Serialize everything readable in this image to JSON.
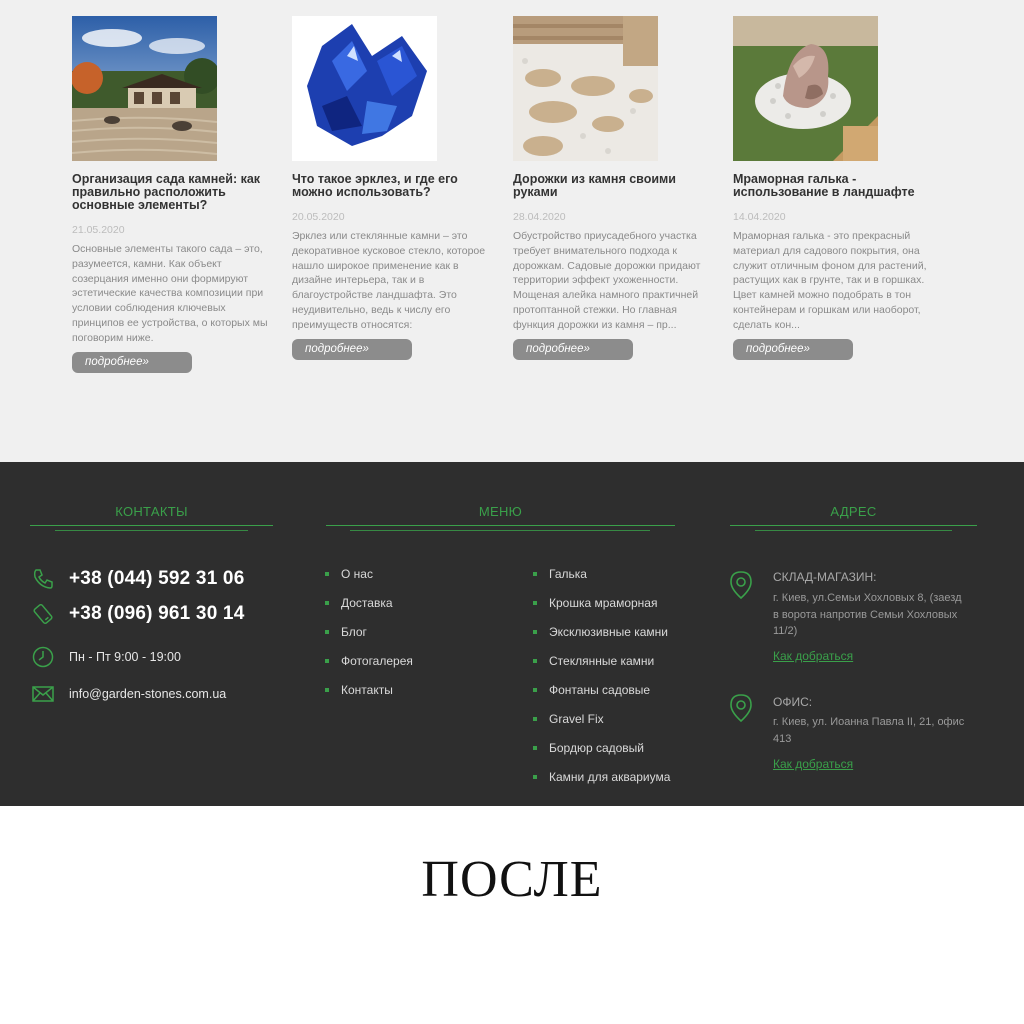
{
  "blog": {
    "more_label": "подробнее»",
    "cards": [
      {
        "title": "Организация сада камней: как правильно расположить основные элементы?",
        "date": "21.05.2020",
        "excerpt": "Основные элементы такого сада – это, разумеется, камни. Как объект созерцания именно они формируют эстетические качества композиции при условии соблюдения ключевых принципов ее устройства, о которых мы поговорим ниже."
      },
      {
        "title": "Что такое эрклез, и где его можно использовать?",
        "date": "20.05.2020",
        "excerpt": "Эрклез или стеклянные камни – это декоративное кусковое стекло, которое нашло широкое применение как в дизайне интерьера, так и в благоустройстве ландшафта.    Это неудивительно, ведь к числу его преимуществ относятся:"
      },
      {
        "title": "Дорожки из камня своими руками",
        "date": "28.04.2020",
        "excerpt": "Обустройство приусадебного участка требует внимательного подхода к дорожкам. Садовые дорожки придают территории эффект ухоженности. Мощеная алейка намного практичней протоптанной стежки. Но главная функция дорожки из камня – пр..."
      },
      {
        "title": "Мраморная галька - использование в ландшафте",
        "date": "14.04.2020",
        "excerpt": "Мраморная галька - это прекрасный материал для садового покрытия, она служит отличным фоном для растений, растущих как в грунте, так и в горшках. Цвет камней можно подобрать в тон контейнерам и горшкам или наоборот, сделать кон..."
      }
    ]
  },
  "footer": {
    "contacts": {
      "heading": "КОНТАКТЫ",
      "phone1": "+38 (044) 592 31 06",
      "phone2": "+38 (096) 961 30 14",
      "hours": "Пн - Пт 9:00 - 19:00",
      "email": "info@garden-stones.com.ua"
    },
    "menu": {
      "heading": "МЕНЮ",
      "col1": [
        "О нас",
        "Доставка",
        "Блог",
        "Фотогалерея",
        "Контакты"
      ],
      "col2": [
        "Галька",
        "Крошка мраморная",
        "Эксклюзивные камни",
        "Стеклянные камни",
        "Фонтаны садовые",
        "Gravel Fix",
        "Бордюр садовый",
        "Камни для аквариума"
      ]
    },
    "address": {
      "heading": "АДРЕС",
      "warehouse_label": "СКЛАД-МАГАЗИН:",
      "warehouse_line1": "г. Киев, ул.Семьи Хохловых 8, (заезд",
      "warehouse_line2": "в ворота напротив Семьи Хохловых",
      "warehouse_line3": "11/2)",
      "office_label": "ОФИС:",
      "office_line1": "г. Киев, ул. Иоанна Павла II, 21, офис",
      "office_line2": "413",
      "directions_label": "Как добраться"
    }
  },
  "caption": "ПОСЛЕ",
  "colors": {
    "accent": "#3aa04a",
    "footer_bg": "#2e2e2e",
    "blog_bg": "#f0f0f0",
    "button": "#8c8c8c"
  }
}
